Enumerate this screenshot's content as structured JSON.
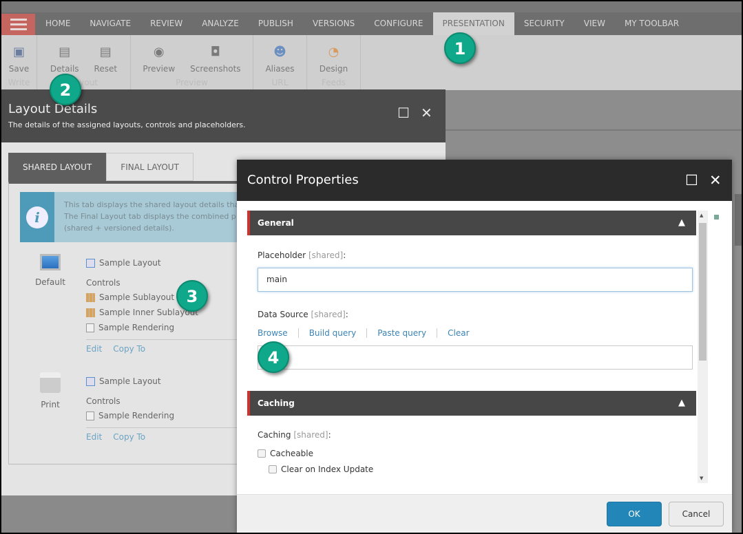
{
  "nav": {
    "tabs": [
      "HOME",
      "NAVIGATE",
      "REVIEW",
      "ANALYZE",
      "PUBLISH",
      "VERSIONS",
      "CONFIGURE",
      "PRESENTATION",
      "SECURITY",
      "VIEW",
      "MY TOOLBAR"
    ],
    "active": "PRESENTATION"
  },
  "ribbon": {
    "groups": [
      {
        "label": "Write",
        "buttons": [
          "Save"
        ]
      },
      {
        "label": "Layout",
        "buttons": [
          "Details",
          "Reset"
        ]
      },
      {
        "label": "Preview",
        "buttons": [
          "Preview",
          "Screenshots"
        ]
      },
      {
        "label": "URL",
        "buttons": [
          "Aliases"
        ]
      },
      {
        "label": "Feeds",
        "buttons": [
          "Design"
        ]
      }
    ]
  },
  "layout_details": {
    "title": "Layout Details",
    "subtitle": "The details of the assigned layouts, controls and placeholders.",
    "tabs": [
      "SHARED LAYOUT",
      "FINAL LAYOUT"
    ],
    "info": [
      "This tab displays the shared layout details tha",
      "The Final Layout tab displays the combined p",
      "(shared + versioned details)."
    ],
    "devices": [
      {
        "name": "Default",
        "layout": "Sample Layout",
        "controls_label": "Controls",
        "controls": [
          "Sample Sublayout",
          "Sample Inner Sublayout",
          "Sample Rendering"
        ],
        "edit": "Edit",
        "copy": "Copy To"
      },
      {
        "name": "Print",
        "layout": "Sample Layout",
        "controls_label": "Controls",
        "controls": [
          "Sample Rendering"
        ],
        "edit": "Edit",
        "copy": "Copy To"
      }
    ]
  },
  "control_properties": {
    "title": "Control Properties",
    "general": "General",
    "placeholder_label": "Placeholder",
    "shared_tag": "[shared]",
    "colon": ":",
    "placeholder_value": "main",
    "datasource_label": "Data Source",
    "ds_links": [
      "Browse",
      "Build query",
      "Paste query",
      "Clear"
    ],
    "caching": "Caching",
    "caching_label": "Caching",
    "cacheable": "Cacheable",
    "clear_index": "Clear on Index Update",
    "ok": "OK",
    "cancel": "Cancel"
  },
  "badges": [
    "1",
    "2",
    "3",
    "4"
  ],
  "colors": {
    "accent": "#d3312b",
    "badge": "#0fa88a",
    "primary_button": "#2286b8"
  }
}
